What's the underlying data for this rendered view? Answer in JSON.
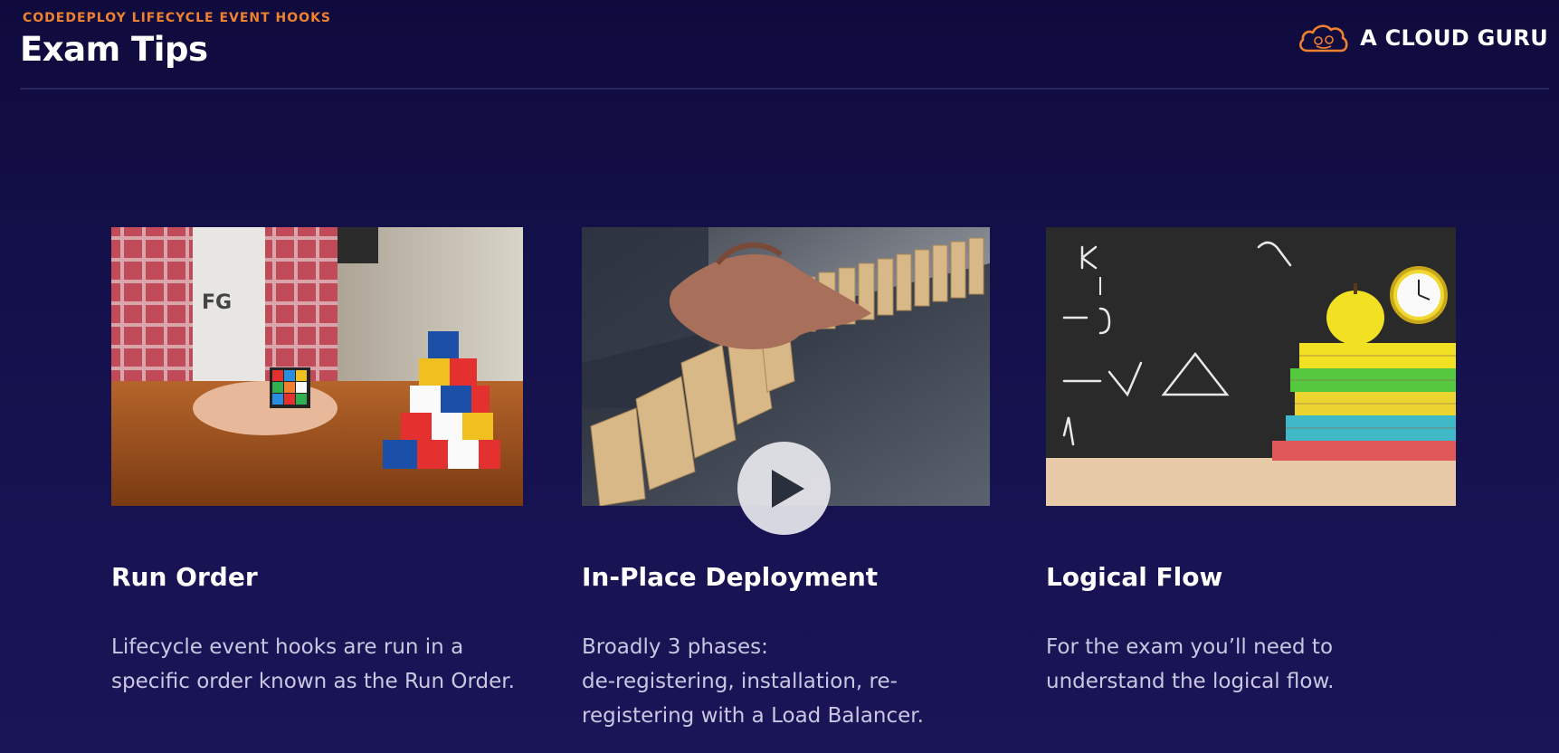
{
  "header": {
    "eyebrow": "CODEDEPLOY LIFECYCLE EVENT HOOKS",
    "title": "Exam Tips",
    "brand_name": "A CLOUD GURU"
  },
  "colors": {
    "background": "#15114d",
    "accent": "#f0812f",
    "title_text": "#ffffff",
    "body_text": "#c9c7e2"
  },
  "cards": [
    {
      "image": "rubiks-cube-blocks-photo",
      "title": "Run Order",
      "body_lines": [
        "Lifecycle event hooks are run in a specific order known as the Run Order."
      ]
    },
    {
      "image": "falling-dominoes-photo",
      "title": "In-Place Deployment",
      "body_lines": [
        "Broadly 3 phases:",
        "de-registering, installation, re-registering with a Load Balancer."
      ]
    },
    {
      "image": "chalkboard-books-clock-photo",
      "title": "Logical Flow",
      "body_lines": [
        "For the exam you’ll need to understand the logical flow."
      ]
    }
  ],
  "video": {
    "control": "play-icon"
  }
}
